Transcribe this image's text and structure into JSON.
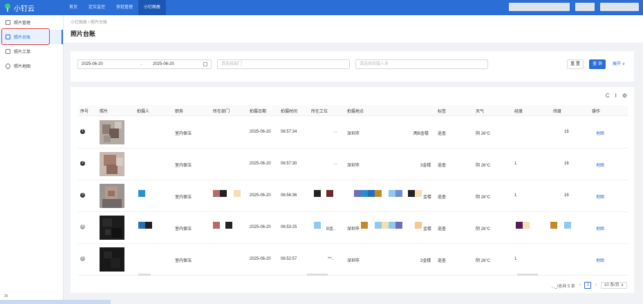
{
  "app": {
    "name": "小钉云"
  },
  "nav": [
    "首页",
    "定位监控",
    "审批管理",
    "小钉图册"
  ],
  "sidebar": {
    "items": [
      "照片管理",
      "照片台账",
      "照片工单",
      "照片地图"
    ],
    "footer": "26"
  },
  "breadcrumb": {
    "parent": "小钉图册",
    "sep": "/",
    "current": "照片台账"
  },
  "page_title": "照片台账",
  "filter": {
    "date_start": "2025-06-20",
    "date_sep": "→",
    "date_end": "2025-06-20",
    "dept_placeholder": "请选择部门",
    "person_placeholder": "请选择拍摄人员",
    "reset_label": "重 置",
    "query_label": "查 询",
    "expand_label": "展开 ∨"
  },
  "table": {
    "headers": [
      "序号",
      "照片",
      "拍摄人",
      "职务",
      "所在部门",
      "拍摄日期",
      "拍摄时间",
      "所在工位",
      "拍摄地点",
      "标签",
      "天气",
      "经度",
      "纬度",
      "操作"
    ],
    "rows": [
      {
        "idx": "1",
        "job": "室内保洁",
        "date": "2025-06-20",
        "time": "06:57:34",
        "place": "深圳市",
        "floor": "两B金楼",
        "tag": "巡查",
        "weather": "阴 26°C",
        "lat": "16",
        "op": "地图",
        "station": "·..",
        "lng": ""
      },
      {
        "idx": "2",
        "job": "室内保洁",
        "date": "2025-06-20",
        "time": "06:57:30",
        "place": "深圳市",
        "floor": "3金楼",
        "tag": "巡查",
        "weather": "阴 26°C",
        "lat": "16",
        "op": "地图",
        "station": "·..",
        "lng": "1"
      },
      {
        "idx": "3",
        "job": "室内保洁",
        "date": "2025-06-20",
        "time": "06:56:36",
        "place": "",
        "floor": "金楼",
        "tag": "巡查",
        "weather": "阴 26°C",
        "lat": "16",
        "op": "地图",
        "station": "",
        "lng": "1"
      },
      {
        "idx": "4",
        "job": "室内保洁",
        "date": "2025-06-20",
        "time": "06:53:25",
        "place": "深圳市",
        "floor": "金楼",
        "tag": "巡查",
        "weather": "阴 26°C",
        "lat": "",
        "op": "地图",
        "station": "B金..",
        "lng": ""
      },
      {
        "idx": "5",
        "job": "室内保洁",
        "date": "2025-06-20",
        "time": "06:52:57",
        "place": "深圳市",
        "floor": "3金楼",
        "tag": "巡查",
        "weather": "阴 26°C",
        "lat": "",
        "op": "地图",
        "station": "^^..",
        "lng": "1"
      }
    ]
  },
  "pagination": {
    "total": "..._/总共 5 条",
    "prev": "<",
    "page": "1",
    "next": ">",
    "size": "10 条/页 ∨"
  },
  "toolbar_icons": {
    "refresh": "C",
    "density": "I",
    "settings": "⚙"
  },
  "colors": {
    "primary": "#2b6fd6",
    "highlight": "#e03a3a"
  }
}
